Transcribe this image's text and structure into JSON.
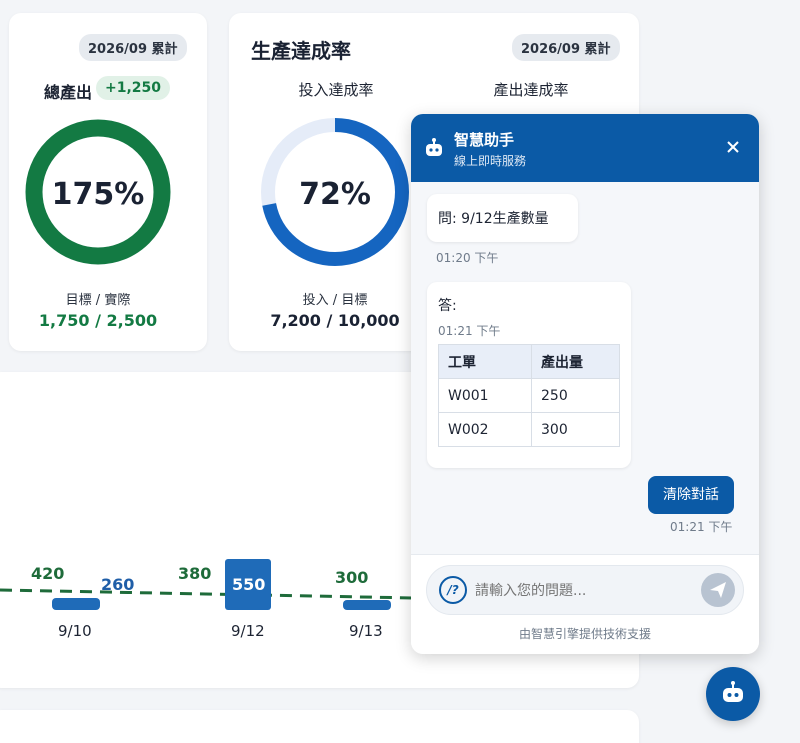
{
  "card1": {
    "badge": "2026/09 累計",
    "title": "總產出",
    "delta": "+1,250",
    "value": "175%",
    "percent": 100,
    "sub_label": "目標 / 實際",
    "sub_value": "1,750 / 2,500",
    "color": "#137a43"
  },
  "card2": {
    "title": "生產達成率",
    "badge": "2026/09 累計",
    "input_label": "投入達成率",
    "output_label": "產出達成率",
    "value": "72%",
    "percent": 72,
    "sub_label": "投入 / 目標",
    "sub_value": "7,200 / 10,000",
    "color": "#1565c0"
  },
  "chart": {
    "points": [
      {
        "date": "9/10",
        "output": "420",
        "input": "260",
        "highlight": false
      },
      {
        "date": "9/12",
        "output": "380",
        "input": "550",
        "highlight": true
      },
      {
        "date": "9/13",
        "output": "300",
        "input": "",
        "highlight": false
      }
    ]
  },
  "chat": {
    "title": "智慧助手",
    "subtitle": "線上即時服務",
    "question": "問: 9/12生產數量",
    "question_time": "01:20 下午",
    "answer_label": "答:",
    "answer_time": "01:21 下午",
    "table": {
      "headers": [
        "工單",
        "產出量"
      ],
      "rows": [
        [
          "W001",
          "250"
        ],
        [
          "W002",
          "300"
        ]
      ]
    },
    "clear_button": "清除對話",
    "clear_time": "01:21 下午",
    "help_icon_text": "/?",
    "placeholder": "請輸入您的問題...",
    "footer": "由智慧引擎提供技術支援"
  }
}
